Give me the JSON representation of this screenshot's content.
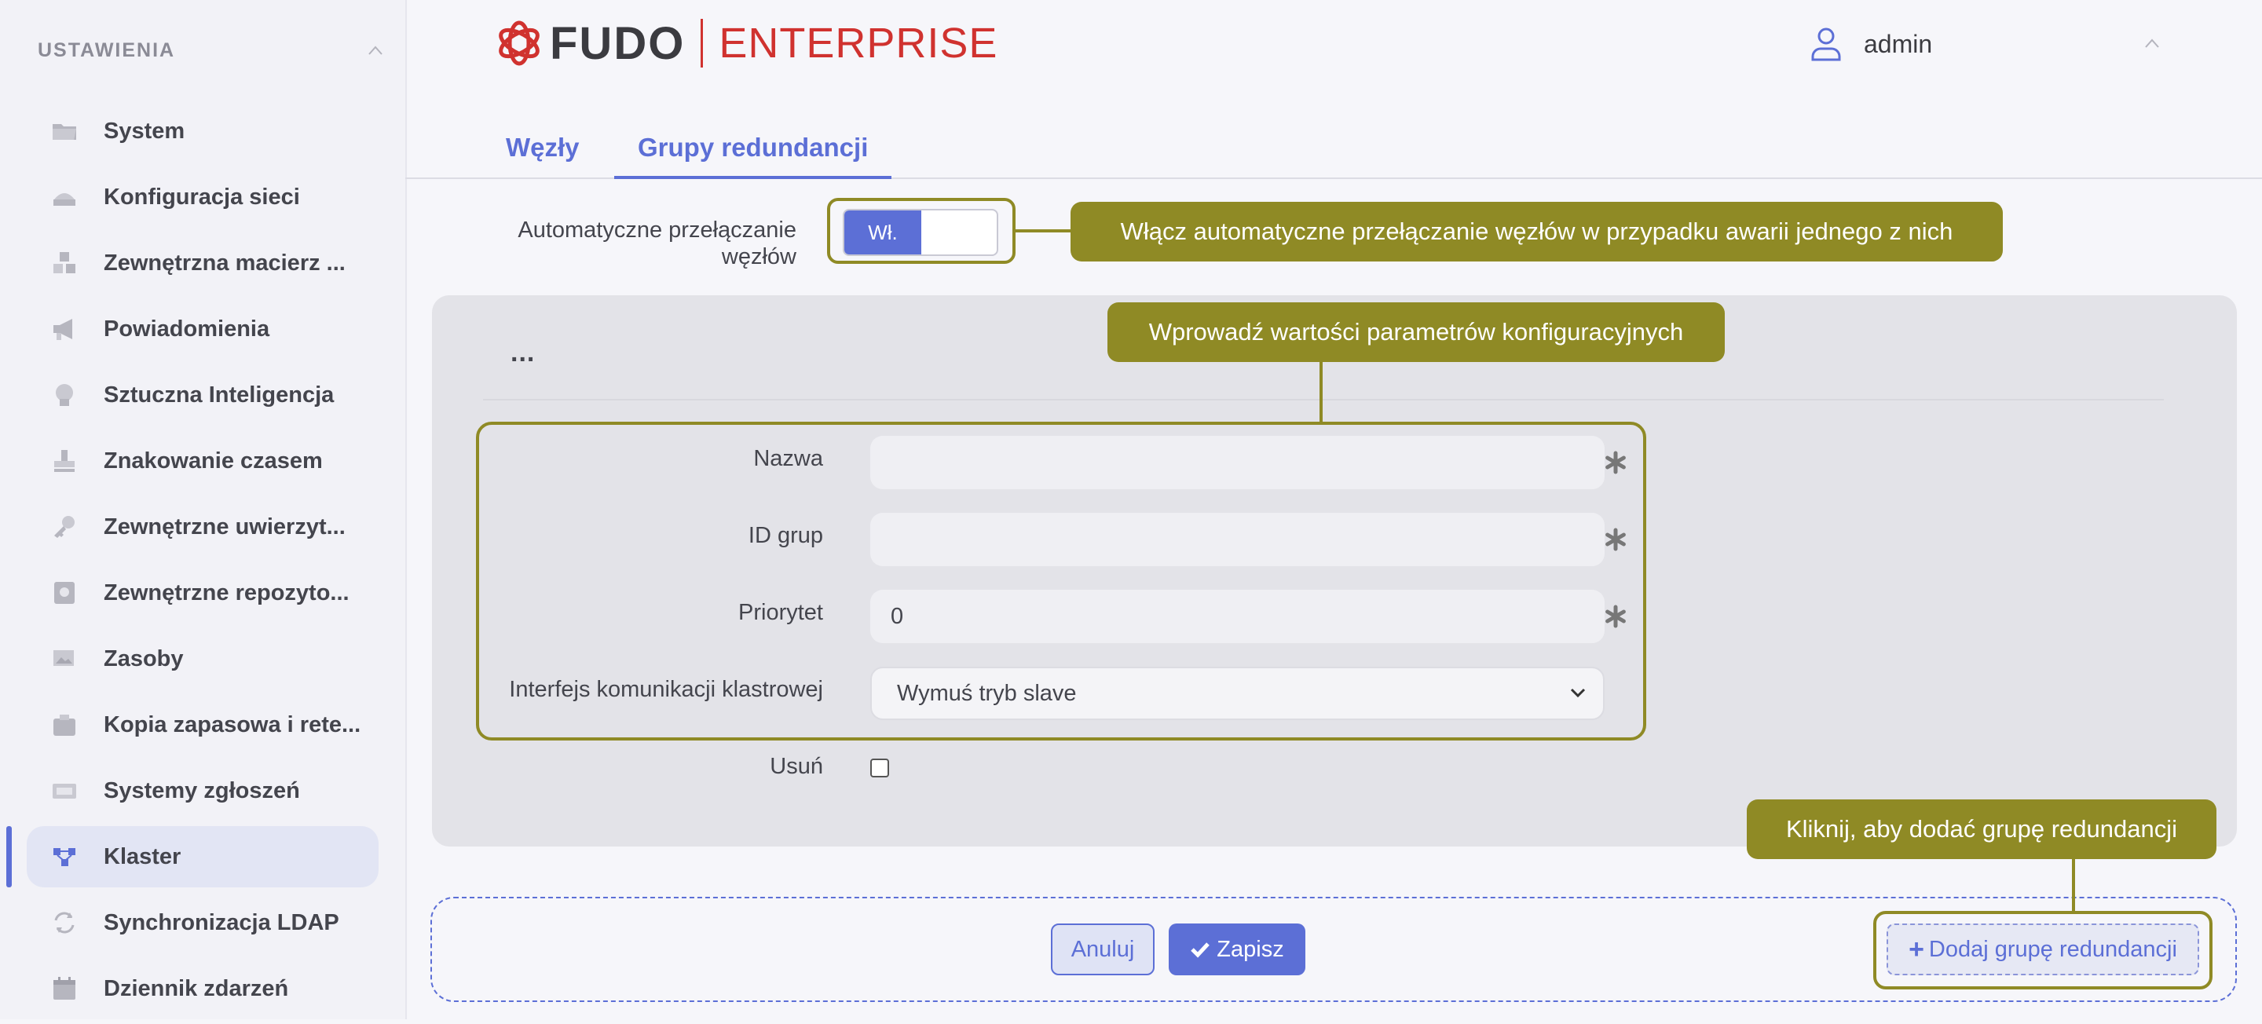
{
  "sidebar": {
    "title": "USTAWIENIA",
    "items": [
      {
        "label": "System",
        "icon": "folder-icon"
      },
      {
        "label": "Konfiguracja sieci",
        "icon": "network-icon"
      },
      {
        "label": "Zewnętrzna macierz ...",
        "icon": "storage-icon"
      },
      {
        "label": "Powiadomienia",
        "icon": "megaphone-icon"
      },
      {
        "label": "Sztuczna Inteligencja",
        "icon": "brain-icon"
      },
      {
        "label": "Znakowanie czasem",
        "icon": "stamp-icon"
      },
      {
        "label": "Zewnętrzne uwierzyt...",
        "icon": "key-icon"
      },
      {
        "label": "Zewnętrzne repozyto...",
        "icon": "vault-icon"
      },
      {
        "label": "Zasoby",
        "icon": "images-icon"
      },
      {
        "label": "Kopia zapasowa i rete...",
        "icon": "backup-icon"
      },
      {
        "label": "Systemy zgłoszeń",
        "icon": "ticket-icon"
      },
      {
        "label": "Klaster",
        "icon": "cluster-icon",
        "active": true
      },
      {
        "label": "Synchronizacja LDAP",
        "icon": "sync-icon"
      },
      {
        "label": "Dziennik zdarzeń",
        "icon": "calendar-icon"
      }
    ]
  },
  "header": {
    "logo_primary": "FUDO",
    "logo_secondary": "ENTERPRISE",
    "user": "admin"
  },
  "tabs": [
    {
      "label": "Węzły"
    },
    {
      "label": "Grupy redundancji",
      "active": true
    }
  ],
  "auto_switch": {
    "label": "Automatyczne przełączanie węzłów",
    "state": "Wł."
  },
  "group": {
    "menu": "...",
    "fields": {
      "name_label": "Nazwa",
      "name_value": "",
      "id_label": "ID grup",
      "id_value": "",
      "priority_label": "Priorytet",
      "priority_value": "0",
      "iface_label": "Interfejs komunikacji klastrowej",
      "iface_value": "Wymuś tryb slave",
      "delete_label": "Usuń"
    }
  },
  "footer": {
    "cancel": "Anuluj",
    "save": "Zapisz",
    "add_group": "Dodaj grupę redundancji"
  },
  "callouts": {
    "auto_switch": "Włącz automatyczne przełączanie węzłów w przypadku awarii jednego z nich",
    "params": "Wprowadź wartości parametrów konfiguracyjnych",
    "add_group": "Kliknij, aby dodać grupę redundancji"
  },
  "colors": {
    "accent": "#5c6fd6",
    "callout": "#8f8a25",
    "brand_red": "#d0322f"
  }
}
